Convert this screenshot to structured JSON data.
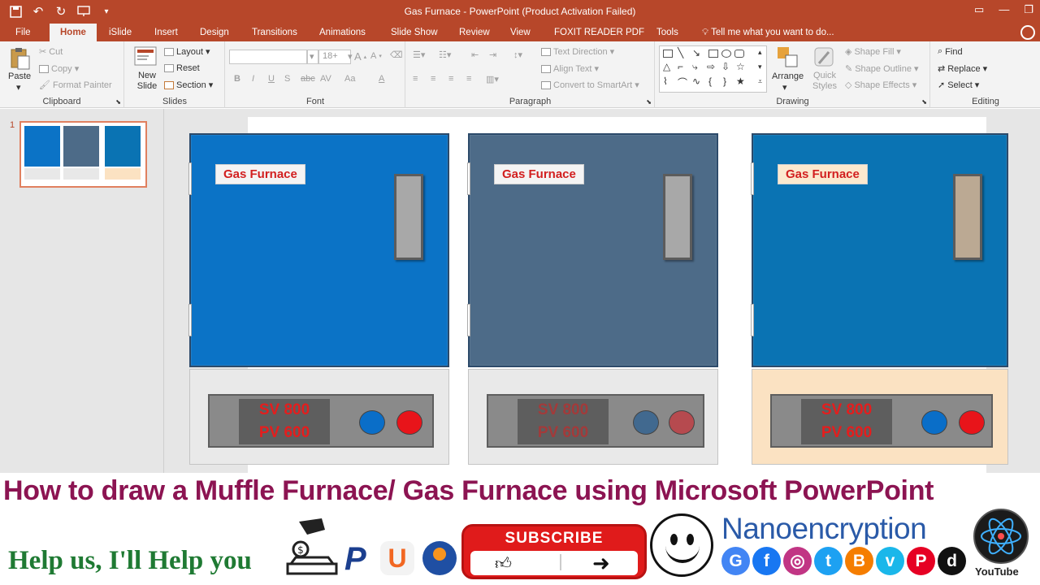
{
  "window": {
    "title": "Gas Furnace - PowerPoint (Product Activation Failed)"
  },
  "qat": {
    "save_icon": "save-icon",
    "undo_icon": "undo-icon",
    "redo_icon": "redo-icon",
    "present_icon": "present-icon",
    "more_icon": "chevron-down-icon"
  },
  "tabs": [
    {
      "label": "File"
    },
    {
      "label": "Home"
    },
    {
      "label": "iSlide"
    },
    {
      "label": "Insert"
    },
    {
      "label": "Design"
    },
    {
      "label": "Transitions"
    },
    {
      "label": "Animations"
    },
    {
      "label": "Slide Show"
    },
    {
      "label": "Review"
    },
    {
      "label": "View"
    },
    {
      "label": "FOXIT READER PDF"
    },
    {
      "label": "Tools"
    }
  ],
  "tell_me": "Tell me what you want to do...",
  "ribbon": {
    "clipboard": {
      "label": "Clipboard",
      "paste": "Paste",
      "cut": "Cut",
      "copy": "Copy",
      "format_painter": "Format Painter"
    },
    "slides": {
      "label": "Slides",
      "new_slide": "New Slide",
      "layout": "Layout",
      "reset": "Reset",
      "section": "Section"
    },
    "font": {
      "label": "Font",
      "size": "18+",
      "b": "B",
      "i": "I",
      "u": "U",
      "s": "S",
      "abc": "abc",
      "av": "AV",
      "aa": "Aa",
      "a": "A"
    },
    "paragraph": {
      "label": "Paragraph",
      "text_direction": "Text Direction",
      "align_text": "Align Text",
      "convert_smartart": "Convert to SmartArt"
    },
    "drawing": {
      "label": "Drawing",
      "arrange": "Arrange",
      "quick_styles": "Quick Styles",
      "shape_fill": "Shape Fill",
      "shape_outline": "Shape Outline",
      "shape_effects": "Shape Effects"
    },
    "editing": {
      "label": "Editing",
      "find": "Find",
      "replace": "Replace",
      "select": "Select"
    }
  },
  "thumbnail": {
    "number": "1"
  },
  "furnaces": [
    {
      "label": "Gas Furnace",
      "sv": "SV 800",
      "pv": "PV 600",
      "door_color": "#0b73c6",
      "handle_color": "#a8a8a8",
      "base_color": "#e9e9e9",
      "knob_left": "#0a6ec8",
      "knob_right": "#e8141a",
      "text_color": "#e51d1d"
    },
    {
      "label": "Gas Furnace",
      "sv": "SV 800",
      "pv": "PV 600",
      "door_color": "#4d6b88",
      "handle_color": "#a8a8a8",
      "base_color": "#e9e9e9",
      "knob_left": "#41698f",
      "knob_right": "#b64a4f",
      "text_color": "#a33a3a"
    },
    {
      "label": "Gas Furnace",
      "sv": "SV 800",
      "pv": "PV 600",
      "door_color": "#0a73b3",
      "handle_color": "#bba993",
      "base_color": "#fbe2c2",
      "knob_left": "#0a6ec8",
      "knob_right": "#e8141a",
      "text_color": "#e51d1d"
    }
  ],
  "banner": {
    "headline": "How to draw a Muffle Furnace/ Gas Furnace using Microsoft PowerPoint",
    "help": "Help us, I'll Help you",
    "subscribe": "SUBSCRIBE",
    "brand": "Nanoencryption",
    "youtube": "YouTube",
    "social": [
      {
        "letter": "G",
        "color": "#4285f4",
        "name": "google-icon"
      },
      {
        "letter": "f",
        "color": "#1877f2",
        "name": "facebook-icon"
      },
      {
        "letter": "◎",
        "color": "#c13584",
        "name": "instagram-icon"
      },
      {
        "letter": "t",
        "color": "#1da1f2",
        "name": "twitter-icon"
      },
      {
        "letter": "B",
        "color": "#f57d00",
        "name": "blogger-icon"
      },
      {
        "letter": "v",
        "color": "#1ab7ea",
        "name": "vimeo-icon"
      },
      {
        "letter": "P",
        "color": "#e60023",
        "name": "pinterest-icon"
      },
      {
        "letter": "d",
        "color": "#111111",
        "name": "dailymotion-icon"
      }
    ]
  }
}
